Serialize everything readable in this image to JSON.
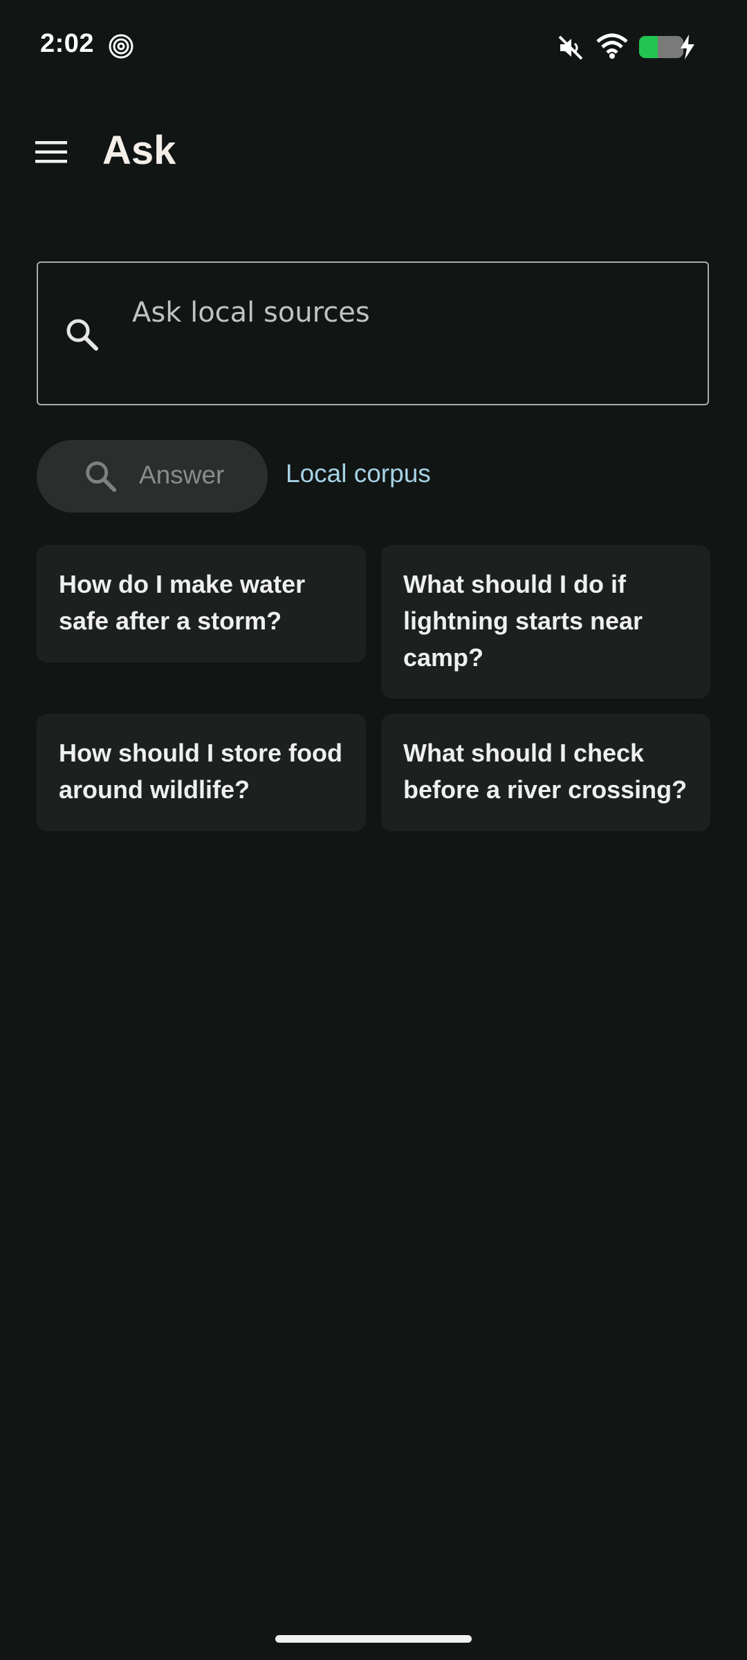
{
  "status_bar": {
    "time": "2:02",
    "icons": [
      "focus-spiral-icon",
      "mute-icon",
      "wifi-icon",
      "battery-charging-icon"
    ],
    "battery_level": 0.42,
    "battery_color": "#23c552"
  },
  "app_bar": {
    "menu_icon": "hamburger-menu-icon",
    "title": "Ask"
  },
  "search": {
    "icon": "search-icon",
    "placeholder": "Ask local sources",
    "value": ""
  },
  "actions": {
    "answer_label": "Answer",
    "answer_icon": "search-icon",
    "local_corpus_label": "Local corpus",
    "accent_color": "#a7d3e6"
  },
  "suggestions": [
    "How do I make water safe after a storm?",
    "What should I do if lightning starts near camp?",
    "How should I store food around wildlife?",
    "What should I check before a river crossing?"
  ],
  "theme": {
    "background": "#111514",
    "card_background": "#1c2120",
    "button_background": "#2b2e2d"
  }
}
